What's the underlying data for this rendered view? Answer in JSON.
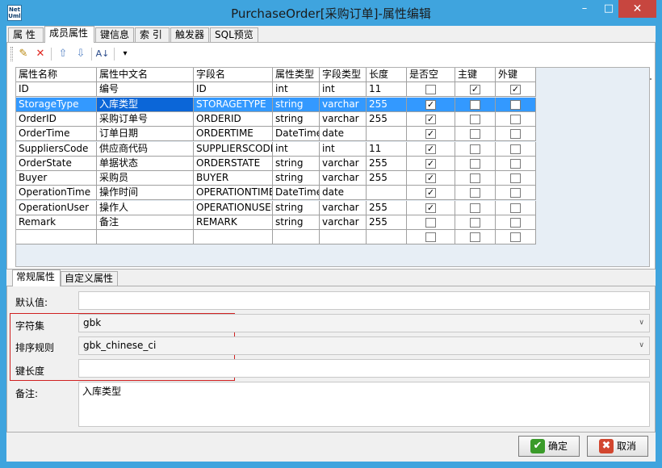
{
  "window": {
    "title": "PurchaseOrder[采购订单]-属性编辑",
    "icon_text_top": "Net",
    "icon_text_bottom": "Uml",
    "minimize": "–",
    "maximize": "□",
    "close": "✕"
  },
  "top_tabs": [
    {
      "label": "属 性",
      "active": false
    },
    {
      "label": "成员属性",
      "active": true
    },
    {
      "label": "键信息",
      "active": false
    },
    {
      "label": "索 引",
      "active": false
    },
    {
      "label": "触发器",
      "active": false
    },
    {
      "label": "SQL预览",
      "active": false
    }
  ],
  "toolbar": {
    "add_icon": "add-member-icon",
    "delete_icon": "delete-icon",
    "up_icon": "move-up-icon",
    "down_icon": "move-down-icon",
    "sort_icon": "sort-az-icon",
    "dropdown_icon": "dropdown-icon",
    "add_glyph": "✎",
    "delete_glyph": "✕",
    "up_glyph": "⇧",
    "down_glyph": "⇩",
    "sort_glyph": "A↓",
    "dropdown_glyph": "▾"
  },
  "grid": {
    "columns": [
      "属性名称",
      "属性中文名",
      "字段名",
      "属性类型",
      "字段类型",
      "长度",
      "是否空",
      "主键",
      "外键"
    ],
    "rows": [
      {
        "name": "ID",
        "cn": "编号",
        "field": "ID",
        "ptype": "int",
        "ftype": "int",
        "len": "11",
        "nullable": false,
        "pk": true,
        "fk": true
      },
      {
        "name": "StorageType",
        "cn": "入库类型",
        "field": "STORAGETYPE",
        "ptype": "string",
        "ftype": "varchar",
        "len": "255",
        "nullable": true,
        "pk": false,
        "fk": false,
        "selected": true
      },
      {
        "name": "OrderID",
        "cn": "采购订单号",
        "field": "ORDERID",
        "ptype": "string",
        "ftype": "varchar",
        "len": "255",
        "nullable": true,
        "pk": false,
        "fk": false
      },
      {
        "name": "OrderTime",
        "cn": "订单日期",
        "field": "ORDERTIME",
        "ptype": "DateTime",
        "ftype": "date",
        "len": "",
        "nullable": true,
        "pk": false,
        "fk": false
      },
      {
        "name": "SuppliersCode",
        "cn": "供应商代码",
        "field": "SUPPLIERSCODE",
        "ptype": "int",
        "ftype": "int",
        "len": "11",
        "nullable": true,
        "pk": false,
        "fk": false
      },
      {
        "name": "OrderState",
        "cn": "单据状态",
        "field": "ORDERSTATE",
        "ptype": "string",
        "ftype": "varchar",
        "len": "255",
        "nullable": true,
        "pk": false,
        "fk": false
      },
      {
        "name": "Buyer",
        "cn": "采购员",
        "field": "BUYER",
        "ptype": "string",
        "ftype": "varchar",
        "len": "255",
        "nullable": true,
        "pk": false,
        "fk": false
      },
      {
        "name": "OperationTime",
        "cn": "操作时间",
        "field": "OPERATIONTIME",
        "ptype": "DateTime",
        "ftype": "date",
        "len": "",
        "nullable": true,
        "pk": false,
        "fk": false
      },
      {
        "name": "OperationUser",
        "cn": "操作人",
        "field": "OPERATIONUSER",
        "ptype": "string",
        "ftype": "varchar",
        "len": "255",
        "nullable": true,
        "pk": false,
        "fk": false
      },
      {
        "name": "Remark",
        "cn": "备注",
        "field": "REMARK",
        "ptype": "string",
        "ftype": "varchar",
        "len": "255",
        "nullable": false,
        "pk": false,
        "fk": false
      },
      {
        "name": "",
        "cn": "",
        "field": "",
        "ptype": "",
        "ftype": "",
        "len": "",
        "nullable": false,
        "pk": false,
        "fk": false
      }
    ]
  },
  "bottom_tabs": [
    {
      "label": "常规属性",
      "active": true
    },
    {
      "label": "自定义属性",
      "active": false
    }
  ],
  "props": {
    "default_label": "默认值:",
    "default_value": "",
    "charset_label": "字符集",
    "charset_value": "gbk",
    "collation_label": "排序规则",
    "collation_value": "gbk_chinese_ci",
    "keylen_label": "键长度",
    "keylen_value": "",
    "remark_label": "备注:",
    "remark_value": "入库类型"
  },
  "buttons": {
    "ok_label": "确定",
    "cancel_label": "取消"
  },
  "colors": {
    "title_bar": "#3fa4de",
    "selection": "#3399ff",
    "close_button": "#c7463f",
    "ok_icon": "#3a9b2a",
    "cancel_icon": "#d2462f"
  }
}
